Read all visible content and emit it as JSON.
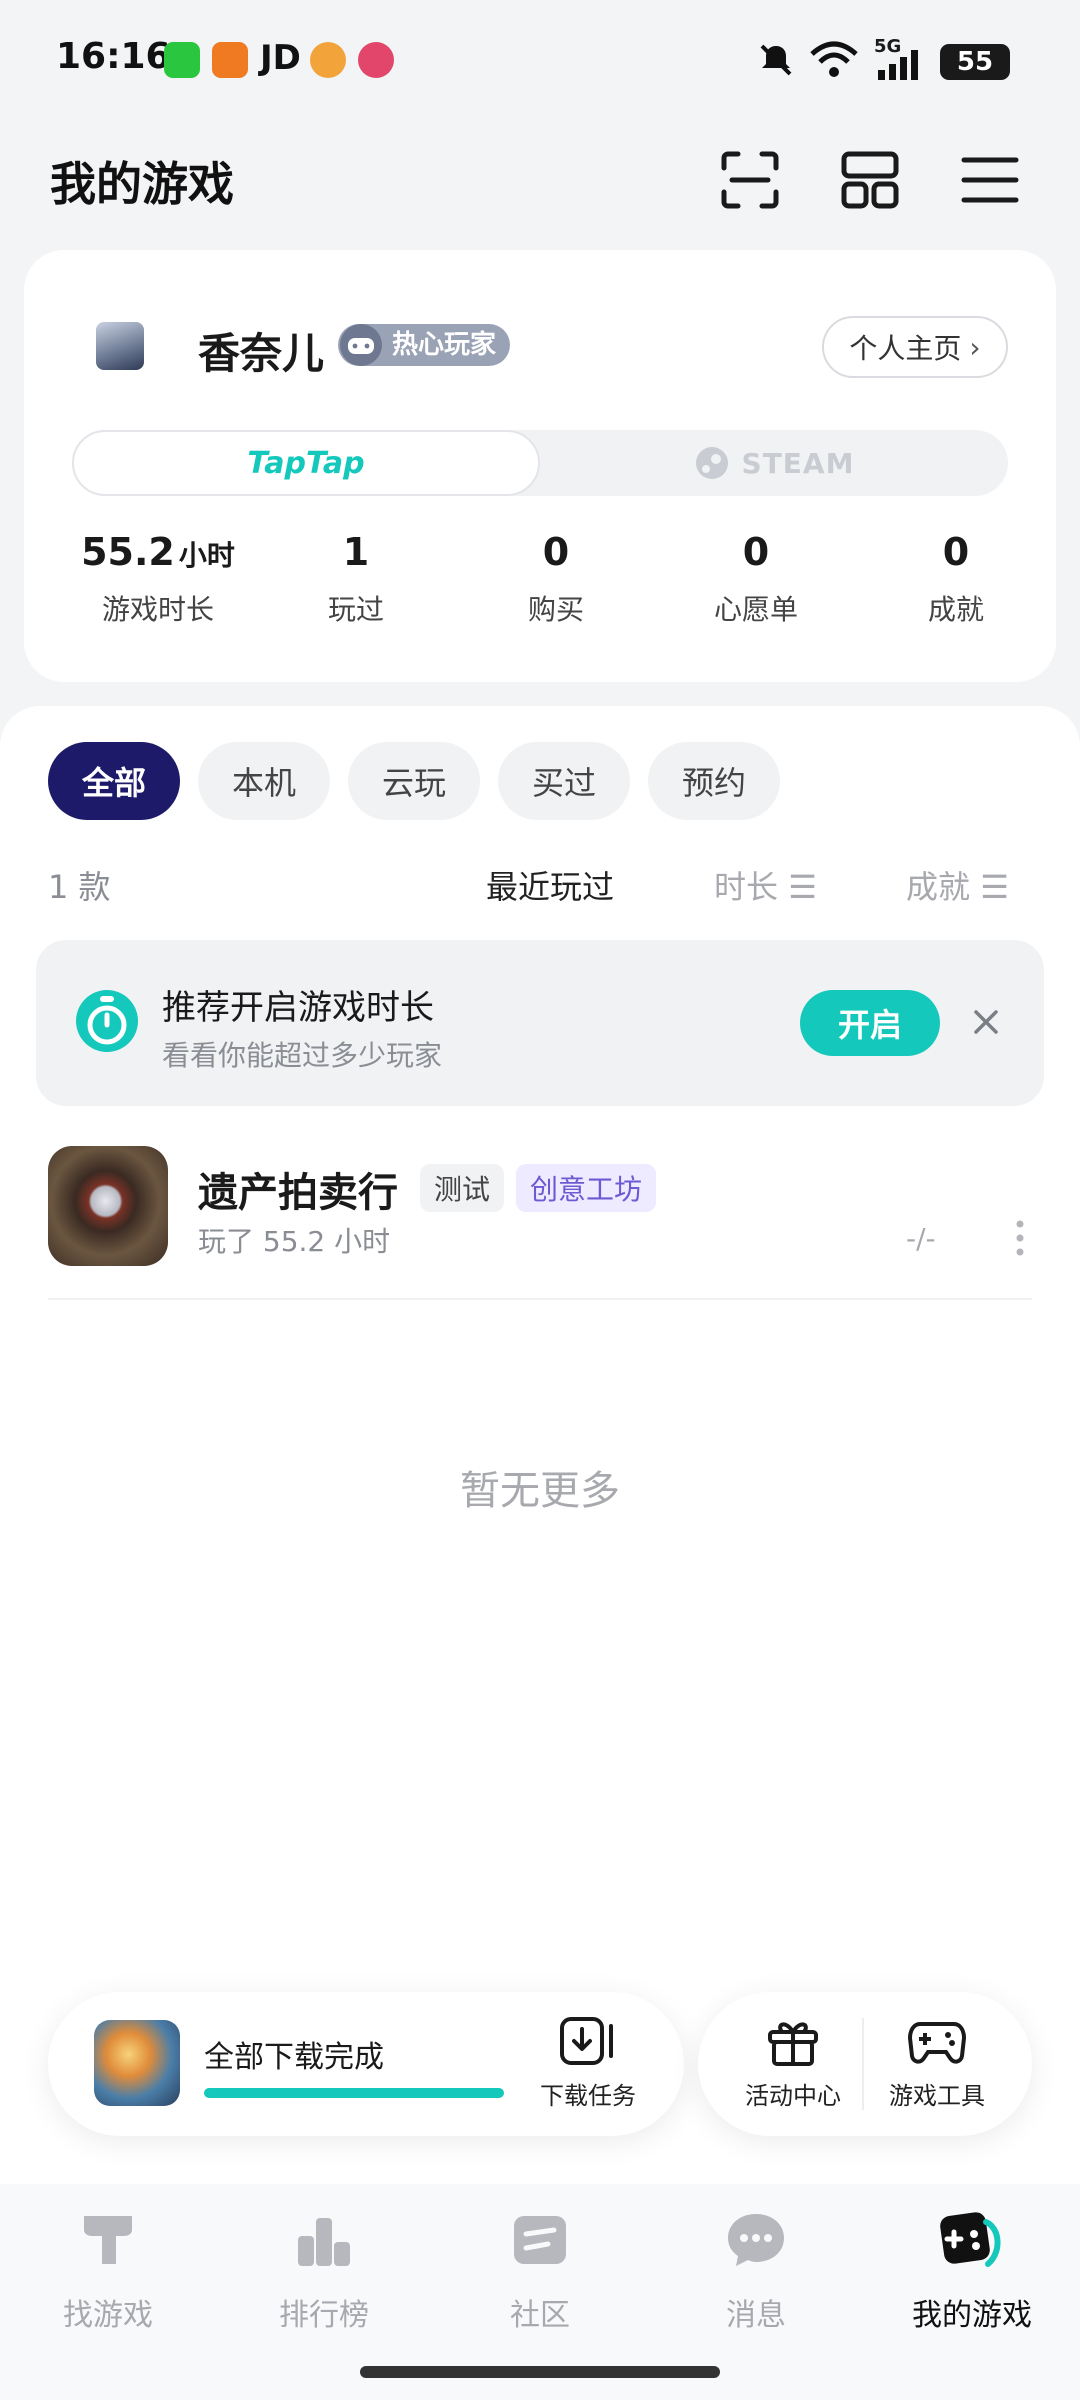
{
  "status": {
    "time": "16:16",
    "jd": "JD",
    "battery": "55",
    "network": "5G"
  },
  "header": {
    "title": "我的游戏",
    "icons": [
      "scan-icon",
      "grid-icon",
      "menu-icon"
    ]
  },
  "profile": {
    "name": "香奈儿",
    "badge": "热心玩家",
    "homepage_label": "个人主页",
    "platforms": [
      "TapTap",
      "STEAM"
    ],
    "active_platform": "TapTap",
    "stats": [
      {
        "value": "55.2",
        "unit": "小时",
        "label": "游戏时长"
      },
      {
        "value": "1",
        "unit": "",
        "label": "玩过"
      },
      {
        "value": "0",
        "unit": "",
        "label": "购买"
      },
      {
        "value": "0",
        "unit": "",
        "label": "心愿单"
      },
      {
        "value": "0",
        "unit": "",
        "label": "成就"
      }
    ]
  },
  "filters": {
    "chips": [
      "全部",
      "本机",
      "云玩",
      "买过",
      "预约"
    ],
    "active": "全部"
  },
  "sort": {
    "count": "1 款",
    "options": [
      "最近玩过",
      "时长",
      "成就"
    ],
    "active": "最近玩过"
  },
  "recommend": {
    "title": "推荐开启游戏时长",
    "subtitle": "看看你能超过多少玩家",
    "button": "开启"
  },
  "games": [
    {
      "name": "遗产拍卖行",
      "tags": [
        "测试",
        "创意工坊"
      ],
      "playtime": "玩了 55.2 小时",
      "achievements": "-/-"
    }
  ],
  "empty_note": "暂无更多",
  "download": {
    "status": "全部下载完成",
    "progress": 1.0,
    "task_label": "下载任务"
  },
  "tools": [
    {
      "label": "活动中心",
      "icon": "gift-icon"
    },
    {
      "label": "游戏工具",
      "icon": "gamepad-icon"
    }
  ],
  "nav": [
    {
      "label": "找游戏",
      "icon": "discover-icon"
    },
    {
      "label": "排行榜",
      "icon": "ranking-icon"
    },
    {
      "label": "社区",
      "icon": "community-icon"
    },
    {
      "label": "消息",
      "icon": "message-icon"
    },
    {
      "label": "我的游戏",
      "icon": "my-games-icon"
    }
  ],
  "nav_active": "我的游戏",
  "colors": {
    "accent": "#14c8bb",
    "active_chip": "#1d1a6a",
    "badge": "#9aa3b6",
    "workshop_tag": "#6d5ad3"
  }
}
